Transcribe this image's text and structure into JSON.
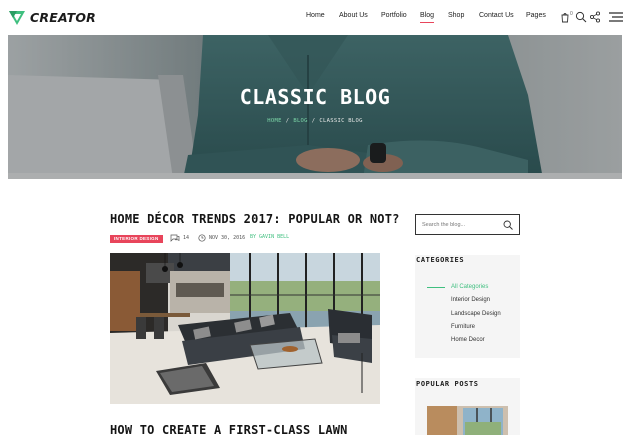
{
  "brand": {
    "name": "CREATOR",
    "accent": "#3fbf7f",
    "highlight": "#e8455b"
  },
  "nav": {
    "items": [
      {
        "label": "Home"
      },
      {
        "label": "About Us"
      },
      {
        "label": "Portfolio"
      },
      {
        "label": "Blog",
        "active": true
      },
      {
        "label": "Shop"
      },
      {
        "label": "Contact Us"
      },
      {
        "label": "Pages"
      }
    ],
    "cart_count": "0",
    "icons": [
      "cart-icon",
      "search-icon",
      "share-icon",
      "menu-icon"
    ]
  },
  "hero": {
    "title": "CLASSIC BLOG",
    "breadcrumb": {
      "home": "HOME",
      "blog": "BLOG",
      "current": "CLASSIC BLOG",
      "separator": "/"
    }
  },
  "post": {
    "title": "HOME DÉCOR TRENDS 2017: POPULAR OR NOT?",
    "category": "INTERIOR DESIGN",
    "comments": "14",
    "date": "NOV 30, 2016",
    "author_prefix": "BY",
    "author": "GAVIN BELL"
  },
  "post2": {
    "title": "HOW TO CREATE A FIRST-CLASS LAWN"
  },
  "sidebar": {
    "search_placeholder": "Search the blog...",
    "categories_title": "CATEGORIES",
    "categories": [
      {
        "label": "All Categories",
        "active": true
      },
      {
        "label": "Interior Design"
      },
      {
        "label": "Landscape Design"
      },
      {
        "label": "Furniture"
      },
      {
        "label": "Home Decor"
      }
    ],
    "popular_title": "POPULAR POSTS"
  }
}
